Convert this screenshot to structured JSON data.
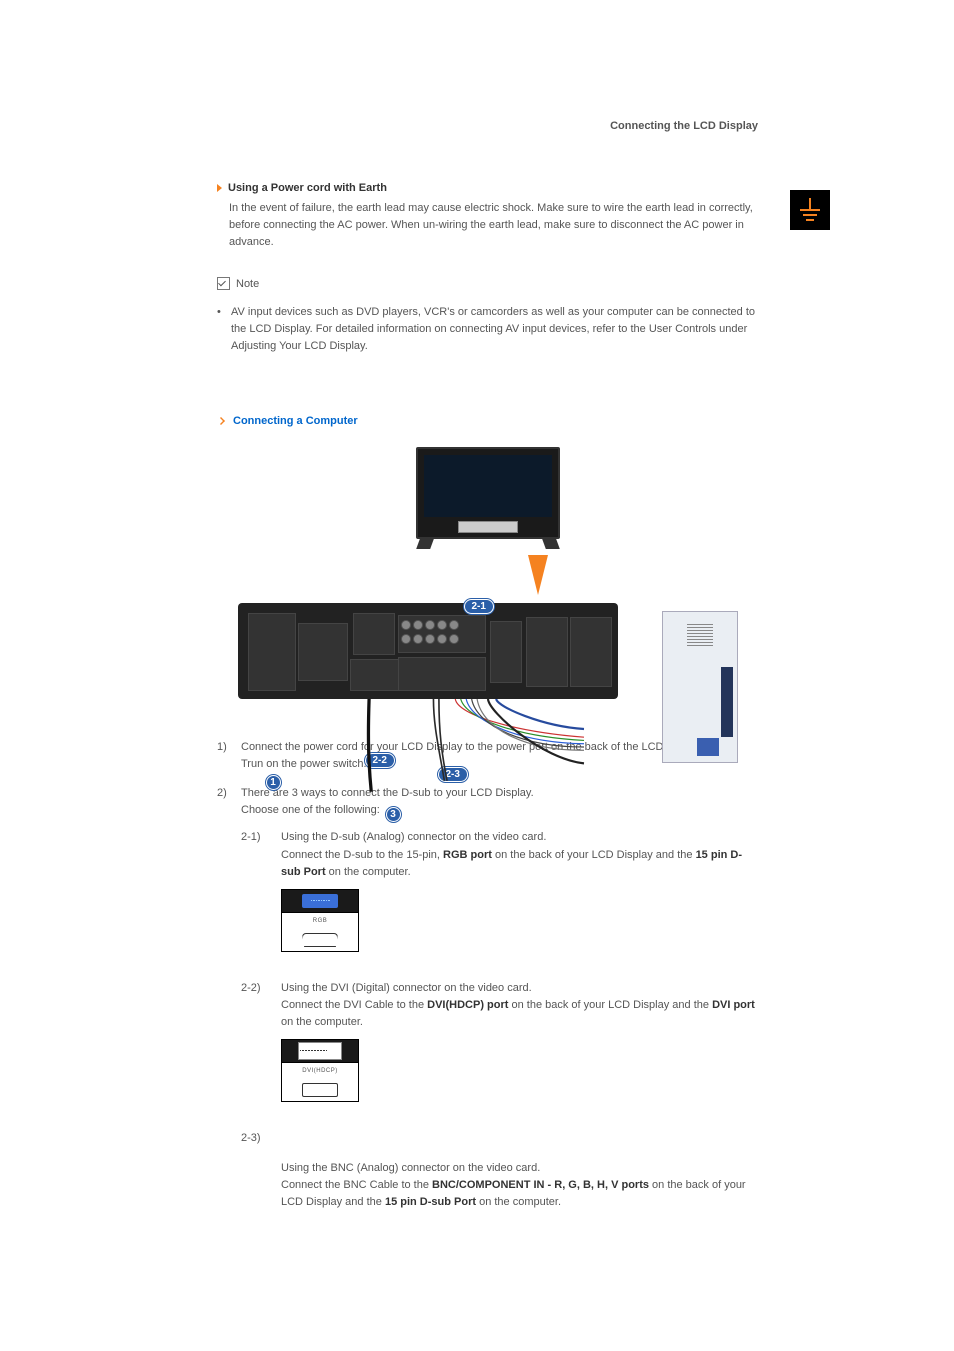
{
  "header": {
    "title": "Connecting the LCD Display"
  },
  "earth": {
    "heading": "Using a Power cord with Earth",
    "body": "In the event of failure, the earth lead may cause electric shock. Make sure to wire the earth lead in correctly, before connecting the AC power. When un-wiring the earth lead, make sure to disconnect the AC power in advance."
  },
  "note": {
    "label": "Note",
    "bullet": "AV input devices such as DVD players, VCR's or camcorders as well as your computer can be connected to the LCD Display. For detailed information on connecting AV input devices, refer to the User Controls under Adjusting Your LCD Display."
  },
  "sub1": {
    "heading": "Connecting a Computer"
  },
  "callouts": {
    "c1": "1",
    "c21": "2-1",
    "c22": "2-2",
    "c23": "2-3",
    "c3": "3"
  },
  "steps": {
    "s1": {
      "num": "1)",
      "lines": [
        "Connect the power cord for your LCD Display to the power port on the back of the LCD Display.",
        "Trun on the power switch."
      ]
    },
    "s2": {
      "num": "2)",
      "intro1": "There are 3 ways to connect the D-sub to your LCD Display.",
      "intro2": "Choose one of the following:",
      "sub21": {
        "num": "2-1)",
        "line1": "Using the D-sub (Analog) connector on the video card.",
        "seg_a": "Connect the D-sub to the 15-pin, ",
        "seg_b": "RGB port",
        "seg_c": " on the back of your LCD Display and the ",
        "seg_d": "15 pin D-sub Port",
        "seg_e": " on the computer.",
        "port_label": "RGB"
      },
      "sub22": {
        "num": "2-2)",
        "line1": "Using the DVI (Digital) connector on the video card.",
        "seg_a": "Connect the DVI Cable to the ",
        "seg_b": "DVI(HDCP) port",
        "seg_c": " on the back of your LCD Display and the ",
        "seg_d": "DVI port",
        "seg_e": " on the computer.",
        "port_label": "DVI(HDCP)"
      },
      "sub23": {
        "num": "2-3)",
        "line1": "Using the BNC (Analog) connector on the video card.",
        "seg_a": "Connect the BNC Cable to the ",
        "seg_b": "BNC/COMPONENT IN - R, G, B, H, V ports",
        "seg_c": " on the back of your LCD Display and the ",
        "seg_d": "15 pin D-sub Port",
        "seg_e": " on the computer."
      }
    }
  }
}
